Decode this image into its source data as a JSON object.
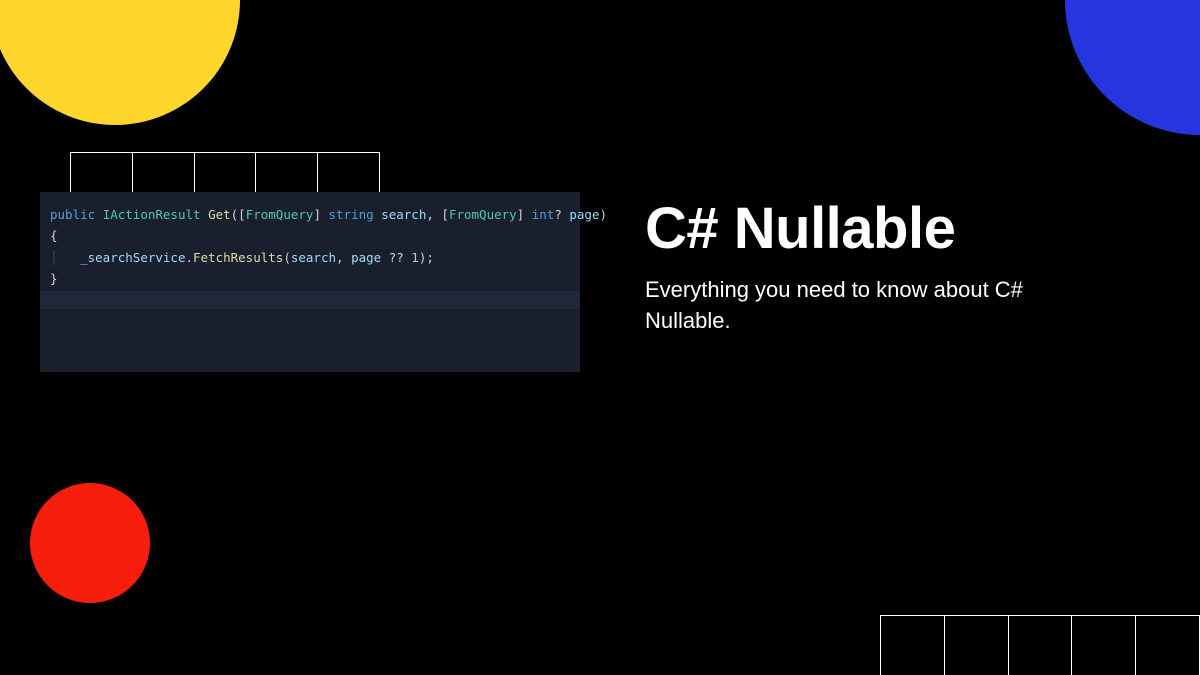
{
  "title": "C# Nullable",
  "subtitle": "Everything you need to know about C# Nullable.",
  "code": {
    "line1": {
      "public": "public",
      "type": "IActionResult",
      "method": "Get",
      "open_paren": "(",
      "attr1_open": "[",
      "attr1": "FromQuery",
      "attr1_close": "]",
      "string_kw": "string",
      "param1": "search",
      "comma1": ", ",
      "attr2_open": "[",
      "attr2": "FromQuery",
      "attr2_close": "]",
      "int_kw": "int",
      "nullable": "?",
      "param2": "page",
      "close_paren": ")"
    },
    "line2": "{",
    "line3": {
      "guide": "│   ",
      "field": "_searchService",
      "dot": ".",
      "method": "FetchResults",
      "open": "(",
      "arg1": "search",
      "comma": ", ",
      "arg2": "page",
      "coalesce": " ?? ",
      "num": "1",
      "close": ");"
    },
    "line4": "}"
  }
}
